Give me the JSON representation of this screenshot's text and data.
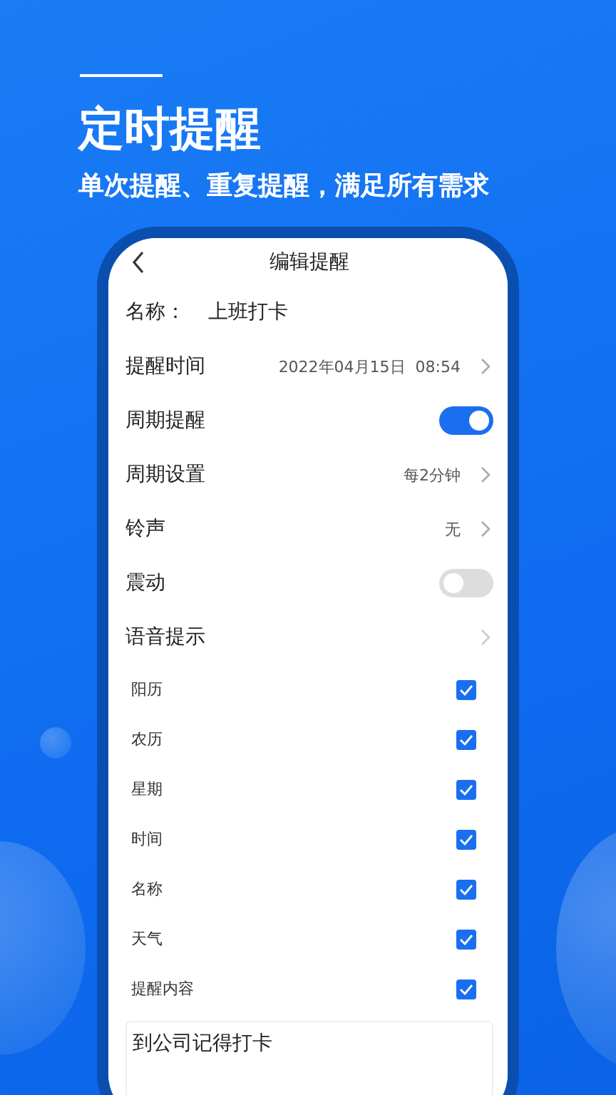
{
  "headline": "定时提醒",
  "subheadline": "单次提醒、重复提醒，满足所有需求",
  "screen": {
    "title": "编辑提醒",
    "name_label": "名称：",
    "name_value": "上班打卡",
    "rows": [
      {
        "kind": "value",
        "label": "提醒时间",
        "value": "2022年04月15日  08:54"
      },
      {
        "kind": "toggle",
        "label": "周期提醒",
        "on": true
      },
      {
        "kind": "value",
        "label": "周期设置",
        "value": "每2分钟"
      },
      {
        "kind": "value",
        "label": "铃声",
        "value": "无"
      },
      {
        "kind": "toggle",
        "label": "震动",
        "on": false
      },
      {
        "kind": "link",
        "label": "语音提示"
      }
    ],
    "voice_options": [
      {
        "label": "阳历",
        "checked": true
      },
      {
        "label": "农历",
        "checked": true
      },
      {
        "label": "星期",
        "checked": true
      },
      {
        "label": "时间",
        "checked": true
      },
      {
        "label": "名称",
        "checked": true
      },
      {
        "label": "天气",
        "checked": true
      },
      {
        "label": "提醒内容",
        "checked": true
      }
    ],
    "note": "到公司记得打卡"
  }
}
